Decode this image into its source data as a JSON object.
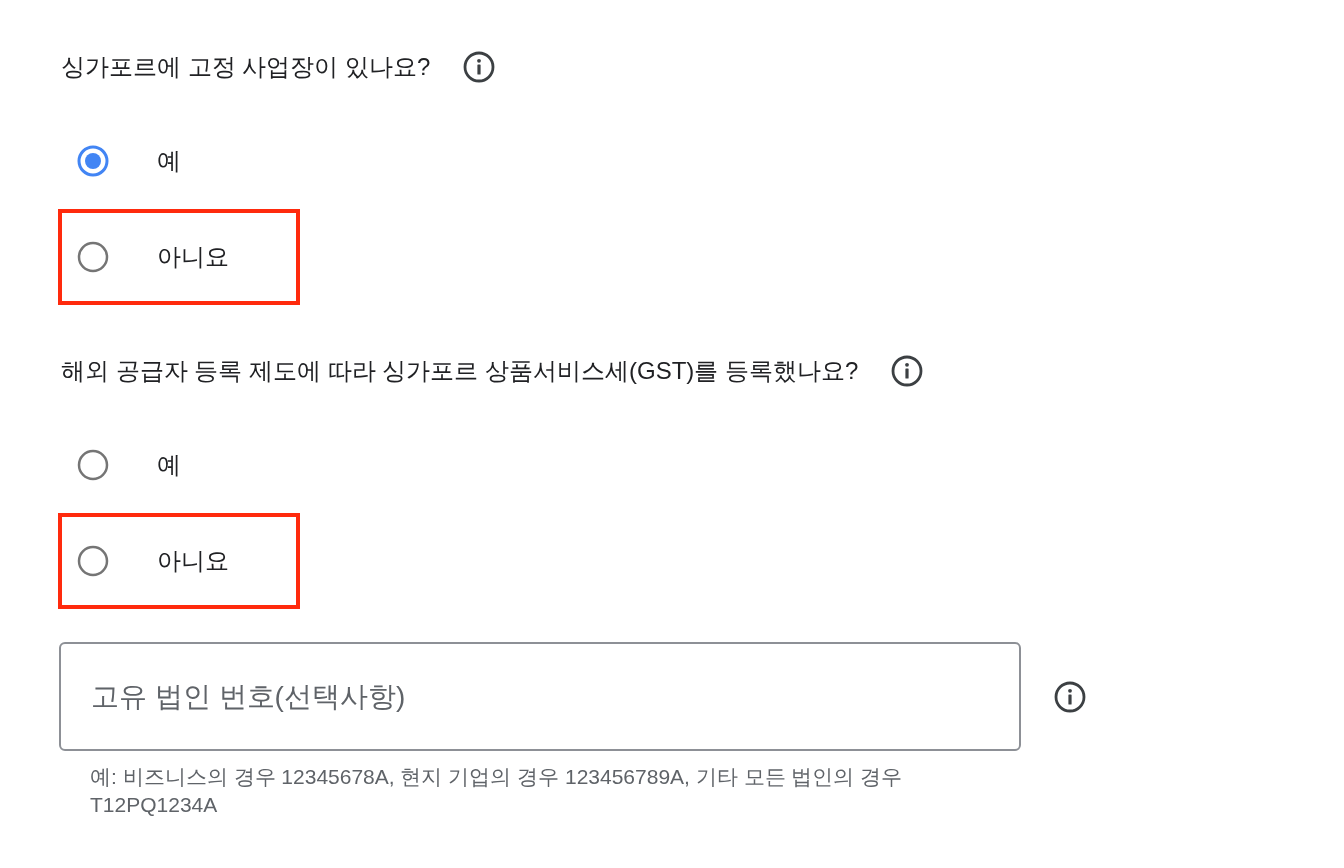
{
  "questions": [
    {
      "text": "싱가포르에 고정 사업장이 있나요?",
      "options": [
        {
          "label": "예",
          "selected": true,
          "highlighted": false
        },
        {
          "label": "아니요",
          "selected": false,
          "highlighted": true
        }
      ]
    },
    {
      "text": "해외 공급자 등록 제도에 따라 싱가포르 상품서비스세(GST)를 등록했나요?",
      "options": [
        {
          "label": "예",
          "selected": false,
          "highlighted": false
        },
        {
          "label": "아니요",
          "selected": false,
          "highlighted": true
        }
      ]
    }
  ],
  "entity_field": {
    "placeholder": "고유 법인 번호(선택사항)",
    "helper": "예: 비즈니스의 경우 12345678A, 현지 기업의 경우 123456789A, 기타 모든 법인의 경우 T12PQ1234A"
  }
}
